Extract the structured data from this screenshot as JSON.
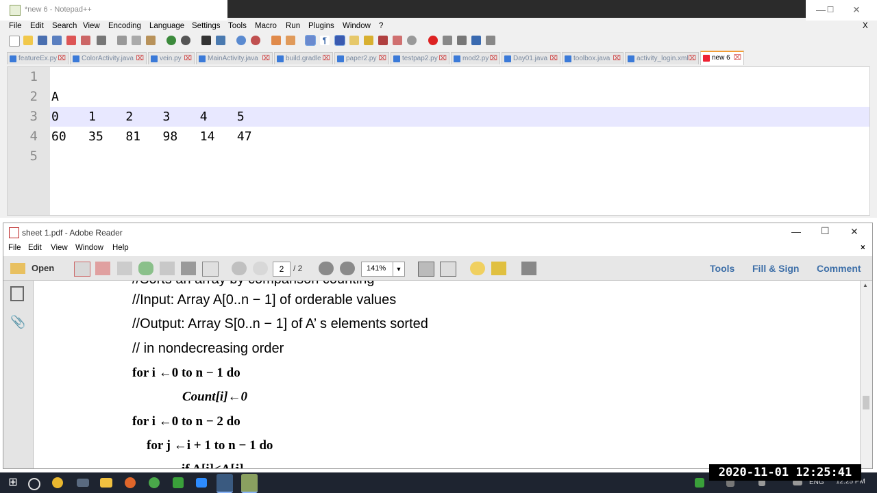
{
  "notepad": {
    "title": "*new 6 - Notepad++",
    "menu": [
      "File",
      "Edit",
      "Search",
      "View",
      "Encoding",
      "Language",
      "Settings",
      "Tools",
      "Macro",
      "Run",
      "Plugins",
      "Window",
      "?"
    ],
    "menu_close": "X",
    "tabs": [
      "featureEx.py",
      "ColorActivity.java",
      "vein.py",
      "MainActivity.java",
      "build.gradle",
      "paper2.py",
      "testpap2.py",
      "mod2.py",
      "Day01.java",
      "toolbox.java",
      "activity_login.xml",
      "new 6"
    ],
    "active_tab": "new 6",
    "line_numbers": [
      "1",
      "2",
      "3",
      "4",
      "5"
    ],
    "lines": [
      "",
      "A",
      "0    1    2    3    4    5",
      "60   35   81   98   14   47",
      ""
    ]
  },
  "reader": {
    "title": "sheet 1.pdf - Adobe Reader",
    "menu": [
      "File",
      "Edit",
      "View",
      "Window",
      "Help"
    ],
    "open_label": "Open",
    "page_current": "2",
    "page_total": "/ 2",
    "zoom": "141%",
    "right_buttons": [
      "Tools",
      "Fill & Sign",
      "Comment"
    ],
    "page_lines": {
      "l0": "//Sorts an array by comparison counting",
      "l1": "//Input: Array A[0..n − 1] of orderable values",
      "l2": "//Output: Array S[0..n − 1] of A’  s elements sorted",
      "l3": "// in nondecreasing order",
      "l4": "for i ←0 to n − 1 do",
      "l5": "Count[i]←0",
      "l6": "for i ←0 to n − 2 do",
      "l7": "for j ←i + 1 to n − 1 do",
      "l8": "if A[i]<A[j]"
    }
  },
  "taskbar": {
    "lang": "ENG",
    "time": "12:25 PM"
  },
  "overlay_timestamp": "2020-11-01  12:25:41",
  "colors": {
    "npp_tab_active": "#f29d34",
    "current_line": "#e8e8ff",
    "reader_accent": "#3d6fa8"
  }
}
